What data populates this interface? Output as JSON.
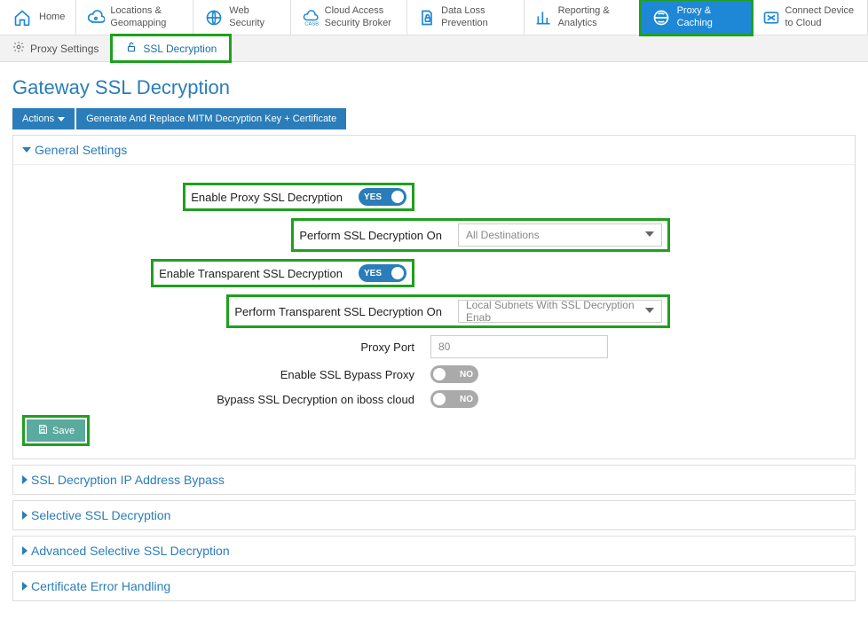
{
  "nav": [
    {
      "label": "Home",
      "icon": "home"
    },
    {
      "label": "Locations & Geomapping",
      "icon": "cloud-loc"
    },
    {
      "label": "Web Security",
      "icon": "globe-shield"
    },
    {
      "label": "Cloud Access Security Broker",
      "icon": "casb"
    },
    {
      "label": "Data Loss Prevention",
      "icon": "file-lock"
    },
    {
      "label": "Reporting & Analytics",
      "icon": "analytics"
    },
    {
      "label": "Proxy & Caching",
      "icon": "globe-arrows",
      "active": true
    },
    {
      "label": "Connect Device to Cloud",
      "icon": "shuffle"
    }
  ],
  "subtabs": {
    "proxy_settings": "Proxy Settings",
    "ssl_decryption": "SSL Decryption"
  },
  "page_title": "Gateway SSL Decryption",
  "actions": {
    "actions_label": "Actions",
    "gen_replace": "Generate And Replace MITM Decryption Key + Certificate"
  },
  "panels": {
    "general": "General Settings",
    "ip_bypass": "SSL Decryption IP Address Bypass",
    "selective": "Selective SSL Decryption",
    "adv_selective": "Advanced Selective SSL Decryption",
    "cert_err": "Certificate Error Handling"
  },
  "form": {
    "enable_proxy_ssl": "Enable Proxy SSL Decryption",
    "perform_ssl_on": "Perform SSL Decryption On",
    "perform_ssl_on_val": "All Destinations",
    "enable_transparent": "Enable Transparent SSL Decryption",
    "perform_transparent_on": "Perform Transparent SSL Decryption On",
    "perform_transparent_on_val": "Local Subnets With SSL Decryption Enab",
    "proxy_port": "Proxy Port",
    "proxy_port_val": "80",
    "enable_bypass_proxy": "Enable SSL Bypass Proxy",
    "bypass_iboss": "Bypass SSL Decryption on iboss cloud",
    "yes": "YES",
    "no": "NO",
    "save": "Save"
  },
  "colors": {
    "accent": "#2a7db8",
    "highlight": "#1fa01f"
  }
}
